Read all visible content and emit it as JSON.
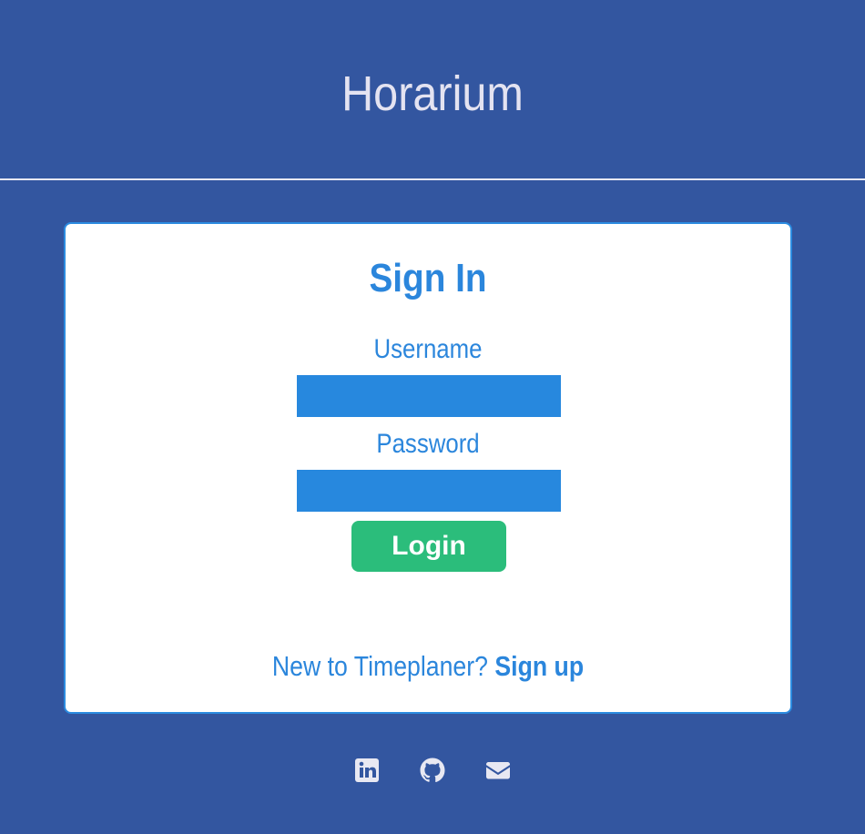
{
  "header": {
    "title": "Horarium"
  },
  "signin": {
    "title": "Sign In",
    "username_label": "Username",
    "username_value": "",
    "password_label": "Password",
    "password_value": "",
    "login_label": "Login",
    "signup_prompt": "New to Timeplaner?",
    "signup_link": "Sign up"
  },
  "footer": {
    "icons": [
      "linkedin-icon",
      "github-icon",
      "email-icon"
    ]
  },
  "colors": {
    "background": "#3356a0",
    "card": "#ffffff",
    "accent": "#2b86dc",
    "input_fill": "#2788de",
    "login_button": "#2bbd7b",
    "header_text": "#e4e3f1"
  }
}
